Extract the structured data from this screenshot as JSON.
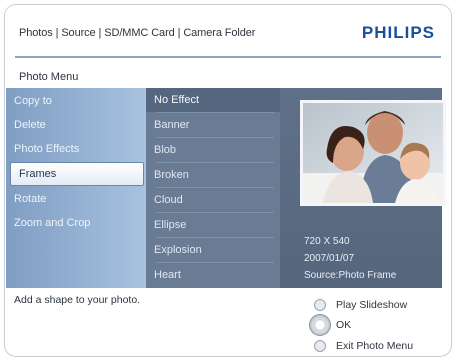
{
  "header": {
    "breadcrumb": "Photos | Source | SD/MMC Card | Camera Folder",
    "brand": "PHILIPS"
  },
  "menu": {
    "title": "Photo Menu",
    "items": [
      {
        "label": "Copy to"
      },
      {
        "label": "Delete"
      },
      {
        "label": "Photo Effects"
      },
      {
        "label": "Frames"
      },
      {
        "label": "Rotate"
      },
      {
        "label": "Zoom and Crop"
      }
    ]
  },
  "submenu": {
    "items": [
      {
        "label": "No Effect"
      },
      {
        "label": "Banner"
      },
      {
        "label": "Blob"
      },
      {
        "label": "Broken"
      },
      {
        "label": "Cloud"
      },
      {
        "label": "Ellipse"
      },
      {
        "label": "Explosion"
      },
      {
        "label": "Heart"
      }
    ]
  },
  "preview": {
    "resolution": "720 X 540",
    "date": "2007/01/07",
    "source": "Source:Photo Frame"
  },
  "footer": {
    "hint": "Add a shape to your photo.",
    "actions": [
      {
        "label": "Play Slideshow"
      },
      {
        "label": "OK"
      },
      {
        "label": "Exit Photo Menu"
      }
    ]
  },
  "colors": {
    "brand": "#1a4f9c",
    "selected_bg": "#ffffff",
    "menu_panel": "#9bb7d8",
    "submenu_panel": "#6a7c94"
  }
}
